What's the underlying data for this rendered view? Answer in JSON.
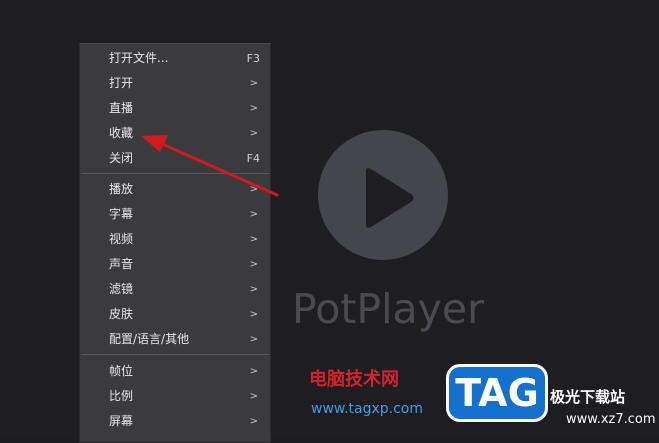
{
  "app": {
    "brand": "PotPlayer"
  },
  "menu": {
    "items": [
      {
        "label": "打开文件...",
        "shortcut": "F3",
        "submenu": false
      },
      {
        "label": "打开",
        "submenu": true
      },
      {
        "label": "直播",
        "submenu": true
      },
      {
        "label": "收藏",
        "submenu": true
      },
      {
        "label": "关闭",
        "shortcut": "F4",
        "submenu": false
      },
      {
        "label": "播放",
        "submenu": true
      },
      {
        "label": "字幕",
        "submenu": true
      },
      {
        "label": "视频",
        "submenu": true
      },
      {
        "label": "声音",
        "submenu": true
      },
      {
        "label": "滤镜",
        "submenu": true
      },
      {
        "label": "皮肤",
        "submenu": true
      },
      {
        "label": "配置/语言/其他",
        "submenu": true
      },
      {
        "label": "帧位",
        "submenu": true
      },
      {
        "label": "比例",
        "submenu": true
      },
      {
        "label": "屏幕",
        "submenu": true
      }
    ],
    "submenu_glyph": ">"
  },
  "watermark": {
    "cn_text": "电脑技术网",
    "url": "www.tagxp.com",
    "tag": "TAG",
    "site": "极光下载站",
    "site_url": "www.xz7.com"
  },
  "colors": {
    "background": "#1d1d22",
    "menu_bg": "#3b3b3e",
    "menu_text": "#e6e6e6",
    "annotation_arrow": "#d11a1a",
    "watermark_red": "#d2232a",
    "watermark_blue": "#1470cc"
  },
  "icons": {
    "play": "play-triangle-icon",
    "arrow": "red-annotation-arrow"
  }
}
